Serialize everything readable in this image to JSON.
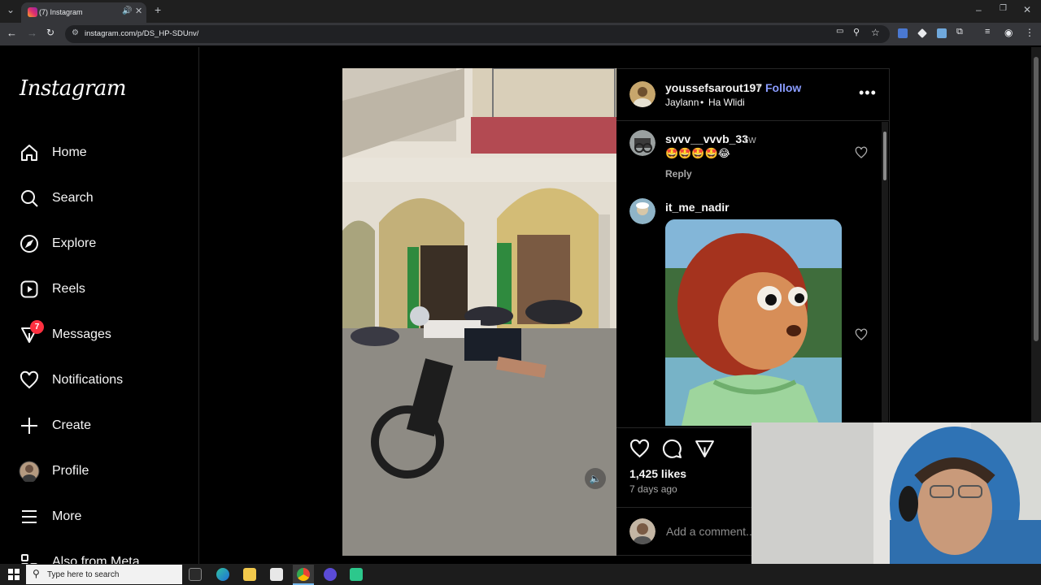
{
  "browser": {
    "tab_title": "(7) Instagram",
    "url": "instagram.com/p/DS_HP-SDUnv/",
    "colors": {
      "tabbar": "#1f1f1f",
      "toolbar": "#35363a"
    }
  },
  "sidebar": {
    "logo": "Instagram",
    "items": [
      {
        "label": "Home",
        "icon": "home-icon"
      },
      {
        "label": "Search",
        "icon": "search-icon"
      },
      {
        "label": "Explore",
        "icon": "compass-icon"
      },
      {
        "label": "Reels",
        "icon": "reels-icon"
      },
      {
        "label": "Messages",
        "icon": "messenger-icon",
        "badge": "7"
      },
      {
        "label": "Notifications",
        "icon": "heart-icon"
      },
      {
        "label": "Create",
        "icon": "plus-icon"
      },
      {
        "label": "Profile",
        "icon": "avatar-icon"
      },
      {
        "label": "More",
        "icon": "hamburger-icon"
      },
      {
        "label": "Also from Meta",
        "icon": "meta-apps-icon"
      }
    ]
  },
  "post": {
    "author": "youssefsarout197",
    "separator": "•",
    "follow_label": "Follow",
    "audio_artist": "Jaylann",
    "audio_title": "Ha Wlidi",
    "more_icon": "more-horizontal-icon",
    "likes": "1,425 likes",
    "date": "7 days ago",
    "comment_placeholder": "Add a comment...",
    "colors": {
      "follow": "#8a9cff",
      "badge": "#ff3040"
    }
  },
  "comments": [
    {
      "username": "svvv__vvvb_33",
      "time": "1w",
      "text": "🤩🤩🤩🤩😂",
      "reply_label": "Reply"
    },
    {
      "username": "it_me_nadir",
      "time": "",
      "text": "",
      "has_image": true
    }
  ],
  "taskbar": {
    "search_placeholder": "Type here to search"
  }
}
